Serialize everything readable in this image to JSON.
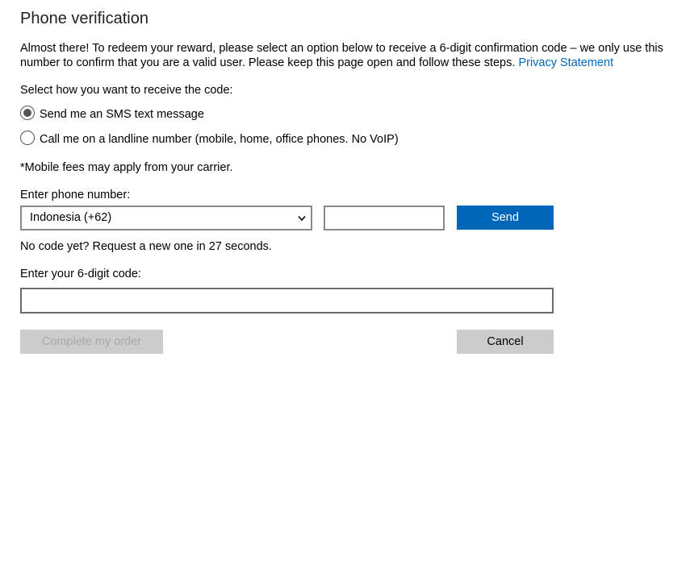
{
  "page": {
    "title": "Phone verification",
    "intro_text": "Almost there! To redeem your reward, please select an option below to receive a 6-digit confirmation code – we only use this number to confirm that you are a valid user. Please keep this page open and follow these steps. ",
    "privacy_link": "Privacy Statement"
  },
  "method": {
    "prompt": "Select how you want to receive the code:",
    "options": [
      {
        "label": "Send me an SMS text message",
        "selected": true
      },
      {
        "label": "Call me on a landline number (mobile, home, office phones. No VoIP)",
        "selected": false
      }
    ],
    "fees_note": "*Mobile fees may apply from your carrier."
  },
  "phone": {
    "label": "Enter phone number:",
    "country_selected": "Indonesia (+62)",
    "number_value": "",
    "send_label": "Send",
    "resend_note": "No code yet? Request a new one in 27 seconds."
  },
  "code": {
    "label": "Enter your 6-digit code:",
    "value": ""
  },
  "actions": {
    "complete_label": "Complete my order",
    "cancel_label": "Cancel"
  },
  "colors": {
    "accent": "#0067b8",
    "disabled_bg": "#cccccc",
    "disabled_text": "#a8a8a8"
  }
}
